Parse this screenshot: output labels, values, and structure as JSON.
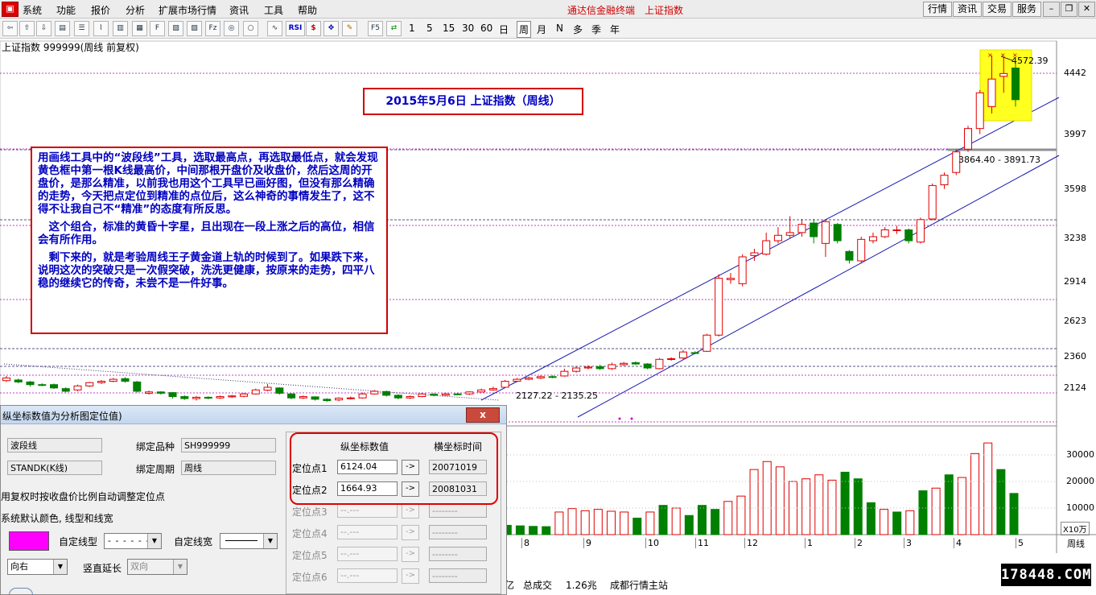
{
  "menu": {
    "items": [
      "系统",
      "功能",
      "报价",
      "分析",
      "扩展市场行情",
      "资讯",
      "工具",
      "帮助"
    ],
    "app_title": "通达信金融终端",
    "app_index": "上证指数",
    "right_buttons": [
      "行情",
      "资讯",
      "交易",
      "服务"
    ]
  },
  "toolbar": {
    "periods": [
      "1",
      "5",
      "15",
      "30",
      "60",
      "日",
      "周",
      "月",
      "N",
      "多",
      "季",
      "年"
    ],
    "active_period": "周",
    "icon_labels": [
      "RSI",
      "$"
    ]
  },
  "chart": {
    "title": "上证指数 999999(周线 前复权)",
    "header_box": "2015年5月6日   上证指数（周线）",
    "y_ticks": [
      "4442",
      "3997",
      "3598",
      "3238",
      "2914",
      "2623",
      "2360",
      "2124"
    ],
    "vol_ticks": [
      "30000",
      "20000",
      "10000"
    ],
    "vol_unit": "X10万",
    "x_labels": [
      "8",
      "9",
      "10",
      "11",
      "12",
      "1",
      "2",
      "3",
      "4",
      "5"
    ],
    "period_label": "周线",
    "annotations": {
      "high": "4572.39",
      "mid": "3864.40 - 3891.73",
      "low": "2127.22 - 2135.25"
    },
    "note": {
      "p1": "用画线工具中的“波段线”工具，选取最高点，再选取最低点，就会发现黄色框中第一根K线最高价，中间那根开盘价及收盘价，然后这周的开盘价，是那么精准，以前我也用这个工具早已画好图，但没有那么精确的走势，今天把点定位到精准的点位后，这么神奇的事情发生了，这不得不让我自己不“精准”的态度有所反思。",
      "p2": "　这个组合，标准的黄昏十字星，且出现在一段上涨之后的高位，相信会有所作用。",
      "p3": "　剩下来的，就是考验周线王子黄金道上轨的时候到了。如果跌下来，说明这次的突破只是一次假突破，洗洗更健康，按原来的走势，四平八稳的继续它的传奇，未尝不是一件好事。"
    },
    "candles": [
      {
        "o": 2180,
        "c": 2200,
        "h": 2215,
        "l": 2170,
        "up": true
      },
      {
        "o": 2185,
        "c": 2170,
        "h": 2195,
        "l": 2160,
        "up": false
      },
      {
        "o": 2170,
        "c": 2150,
        "h": 2178,
        "l": 2135,
        "up": false
      },
      {
        "o": 2150,
        "c": 2145,
        "h": 2160,
        "l": 2138,
        "up": false
      },
      {
        "o": 2150,
        "c": 2125,
        "h": 2158,
        "l": 2118,
        "up": false
      },
      {
        "o": 2120,
        "c": 2100,
        "h": 2130,
        "l": 2092,
        "up": false
      },
      {
        "o": 2110,
        "c": 2140,
        "h": 2150,
        "l": 2100,
        "up": true
      },
      {
        "o": 2140,
        "c": 2165,
        "h": 2170,
        "l": 2132,
        "up": true
      },
      {
        "o": 2165,
        "c": 2175,
        "h": 2185,
        "l": 2155,
        "up": true
      },
      {
        "o": 2175,
        "c": 2190,
        "h": 2200,
        "l": 2168,
        "up": true
      },
      {
        "o": 2195,
        "c": 2175,
        "h": 2205,
        "l": 2165,
        "up": false
      },
      {
        "o": 2170,
        "c": 2100,
        "h": 2178,
        "l": 2090,
        "up": false
      },
      {
        "o": 2085,
        "c": 2095,
        "h": 2105,
        "l": 2075,
        "up": true
      },
      {
        "o": 2095,
        "c": 2085,
        "h": 2100,
        "l": 2075,
        "up": false
      },
      {
        "o": 2090,
        "c": 2060,
        "h": 2095,
        "l": 2045,
        "up": false
      },
      {
        "o": 2060,
        "c": 2045,
        "h": 2070,
        "l": 2035,
        "up": false
      },
      {
        "o": 2045,
        "c": 2055,
        "h": 2065,
        "l": 2030,
        "up": true
      },
      {
        "o": 2055,
        "c": 2048,
        "h": 2062,
        "l": 2040,
        "up": false
      },
      {
        "o": 2050,
        "c": 2060,
        "h": 2068,
        "l": 2042,
        "up": true
      },
      {
        "o": 2058,
        "c": 2065,
        "h": 2072,
        "l": 2050,
        "up": true
      },
      {
        "o": 2062,
        "c": 2080,
        "h": 2088,
        "l": 2055,
        "up": true
      },
      {
        "o": 2080,
        "c": 2110,
        "h": 2120,
        "l": 2075,
        "up": true
      },
      {
        "o": 2108,
        "c": 2130,
        "h": 2155,
        "l": 2100,
        "up": true
      },
      {
        "o": 2125,
        "c": 2085,
        "h": 2130,
        "l": 2075,
        "up": false
      },
      {
        "o": 2080,
        "c": 2050,
        "h": 2085,
        "l": 2040,
        "up": false
      },
      {
        "o": 2050,
        "c": 2060,
        "h": 2068,
        "l": 2042,
        "up": true
      },
      {
        "o": 2058,
        "c": 2040,
        "h": 2062,
        "l": 2030,
        "up": false
      },
      {
        "o": 2040,
        "c": 2030,
        "h": 2048,
        "l": 2020,
        "up": false
      },
      {
        "o": 2035,
        "c": 2048,
        "h": 2055,
        "l": 2025,
        "up": true
      },
      {
        "o": 2045,
        "c": 2050,
        "h": 2060,
        "l": 2038,
        "up": true
      },
      {
        "o": 2050,
        "c": 2080,
        "h": 2090,
        "l": 2045,
        "up": true
      },
      {
        "o": 2080,
        "c": 2100,
        "h": 2110,
        "l": 2075,
        "up": true
      },
      {
        "o": 2098,
        "c": 2070,
        "h": 2105,
        "l": 2060,
        "up": false
      },
      {
        "o": 2070,
        "c": 2050,
        "h": 2078,
        "l": 2040,
        "up": false
      },
      {
        "o": 2050,
        "c": 2060,
        "h": 2068,
        "l": 2042,
        "up": true
      },
      {
        "o": 2060,
        "c": 2080,
        "h": 2088,
        "l": 2055,
        "up": true
      },
      {
        "o": 2078,
        "c": 2070,
        "h": 2085,
        "l": 2062,
        "up": false
      },
      {
        "o": 2070,
        "c": 2080,
        "h": 2090,
        "l": 2065,
        "up": true
      },
      {
        "o": 2080,
        "c": 2075,
        "h": 2088,
        "l": 2070,
        "up": false
      },
      {
        "o": 2080,
        "c": 2095,
        "h": 2100,
        "l": 2072,
        "up": true
      },
      {
        "o": 2095,
        "c": 2110,
        "h": 2120,
        "l": 2090,
        "up": true
      },
      {
        "o": 2110,
        "c": 2120,
        "h": 2135,
        "l": 2104,
        "up": true
      },
      {
        "o": 2130,
        "c": 2175,
        "h": 2185,
        "l": 2125,
        "up": true
      },
      {
        "o": 2175,
        "c": 2190,
        "h": 2200,
        "l": 2168,
        "up": true
      },
      {
        "o": 2190,
        "c": 2200,
        "h": 2210,
        "l": 2183,
        "up": true
      },
      {
        "o": 2200,
        "c": 2210,
        "h": 2220,
        "l": 2192,
        "up": true
      },
      {
        "o": 2210,
        "c": 2205,
        "h": 2220,
        "l": 2198,
        "up": false
      },
      {
        "o": 2215,
        "c": 2250,
        "h": 2270,
        "l": 2210,
        "up": true
      },
      {
        "o": 2250,
        "c": 2275,
        "h": 2285,
        "l": 2240,
        "up": true
      },
      {
        "o": 2275,
        "c": 2282,
        "h": 2295,
        "l": 2265,
        "up": true
      },
      {
        "o": 2285,
        "c": 2270,
        "h": 2300,
        "l": 2260,
        "up": false
      },
      {
        "o": 2270,
        "c": 2300,
        "h": 2315,
        "l": 2260,
        "up": true
      },
      {
        "o": 2300,
        "c": 2310,
        "h": 2320,
        "l": 2292,
        "up": true
      },
      {
        "o": 2315,
        "c": 2305,
        "h": 2325,
        "l": 2298,
        "up": false
      },
      {
        "o": 2305,
        "c": 2275,
        "h": 2312,
        "l": 2265,
        "up": false
      },
      {
        "o": 2270,
        "c": 2340,
        "h": 2350,
        "l": 2265,
        "up": true
      },
      {
        "o": 2340,
        "c": 2345,
        "h": 2355,
        "l": 2330,
        "up": true
      },
      {
        "o": 2350,
        "c": 2395,
        "h": 2410,
        "l": 2340,
        "up": true
      },
      {
        "o": 2390,
        "c": 2385,
        "h": 2400,
        "l": 2378,
        "up": false
      },
      {
        "o": 2400,
        "c": 2520,
        "h": 2530,
        "l": 2395,
        "up": true
      },
      {
        "o": 2520,
        "c": 2940,
        "h": 2970,
        "l": 2510,
        "up": true
      },
      {
        "o": 2930,
        "c": 2940,
        "h": 2980,
        "l": 2900,
        "up": true
      },
      {
        "o": 2900,
        "c": 3100,
        "h": 3120,
        "l": 2880,
        "up": true
      },
      {
        "o": 3110,
        "c": 3130,
        "h": 3160,
        "l": 3070,
        "up": true
      },
      {
        "o": 3120,
        "c": 3220,
        "h": 3280,
        "l": 3110,
        "up": true
      },
      {
        "o": 3220,
        "c": 3260,
        "h": 3320,
        "l": 3200,
        "up": true
      },
      {
        "o": 3260,
        "c": 3280,
        "h": 3400,
        "l": 3240,
        "up": true
      },
      {
        "o": 3280,
        "c": 3340,
        "h": 3380,
        "l": 3250,
        "up": true
      },
      {
        "o": 3350,
        "c": 3250,
        "h": 3380,
        "l": 3200,
        "up": false
      },
      {
        "o": 3200,
        "c": 3360,
        "h": 3380,
        "l": 3100,
        "up": true
      },
      {
        "o": 3340,
        "c": 3220,
        "h": 3350,
        "l": 3200,
        "up": false
      },
      {
        "o": 3140,
        "c": 3075,
        "h": 3150,
        "l": 3050,
        "up": false
      },
      {
        "o": 3070,
        "c": 3230,
        "h": 3250,
        "l": 3050,
        "up": true
      },
      {
        "o": 3220,
        "c": 3250,
        "h": 3280,
        "l": 3200,
        "up": true
      },
      {
        "o": 3250,
        "c": 3300,
        "h": 3320,
        "l": 3240,
        "up": true
      },
      {
        "o": 3300,
        "c": 3300,
        "h": 3330,
        "l": 3270,
        "up": true
      },
      {
        "o": 3300,
        "c": 3220,
        "h": 3310,
        "l": 3200,
        "up": false
      },
      {
        "o": 3210,
        "c": 3375,
        "h": 3390,
        "l": 3200,
        "up": true
      },
      {
        "o": 3380,
        "c": 3625,
        "h": 3640,
        "l": 3370,
        "up": true
      },
      {
        "o": 3630,
        "c": 3700,
        "h": 3720,
        "l": 3600,
        "up": true
      },
      {
        "o": 3720,
        "c": 3870,
        "h": 3890,
        "l": 3700,
        "up": true
      },
      {
        "o": 3890,
        "c": 4040,
        "h": 4060,
        "l": 3870,
        "up": true
      },
      {
        "o": 4040,
        "c": 4300,
        "h": 4320,
        "l": 4000,
        "up": true
      },
      {
        "o": 4200,
        "c": 4400,
        "h": 4572,
        "l": 4150,
        "up": true
      },
      {
        "o": 4420,
        "c": 4440,
        "h": 4560,
        "l": 4300,
        "up": true
      },
      {
        "o": 4480,
        "c": 4250,
        "h": 4520,
        "l": 4200,
        "up": false
      }
    ],
    "volumes": [
      {
        "v": 4000,
        "up": true
      },
      {
        "v": 3800,
        "up": false
      },
      {
        "v": 3500,
        "up": false
      },
      {
        "v": 3300,
        "up": false
      },
      {
        "v": 3100,
        "up": false
      },
      {
        "v": 3000,
        "up": false
      },
      {
        "v": 8500,
        "up": true
      },
      {
        "v": 9800,
        "up": true
      },
      {
        "v": 9000,
        "up": true
      },
      {
        "v": 9500,
        "up": true
      },
      {
        "v": 8800,
        "up": true
      },
      {
        "v": 8500,
        "up": true
      },
      {
        "v": 6200,
        "up": false
      },
      {
        "v": 8500,
        "up": true
      },
      {
        "v": 11000,
        "up": false
      },
      {
        "v": 10000,
        "up": true
      },
      {
        "v": 7200,
        "up": false
      },
      {
        "v": 11000,
        "up": false
      },
      {
        "v": 9500,
        "up": false
      },
      {
        "v": 12500,
        "up": true
      },
      {
        "v": 14500,
        "up": true
      },
      {
        "v": 24500,
        "up": true
      },
      {
        "v": 27500,
        "up": true
      },
      {
        "v": 25500,
        "up": true
      },
      {
        "v": 20000,
        "up": true
      },
      {
        "v": 21000,
        "up": true
      },
      {
        "v": 22500,
        "up": true
      },
      {
        "v": 20500,
        "up": true
      },
      {
        "v": 23500,
        "up": false
      },
      {
        "v": 21000,
        "up": false
      },
      {
        "v": 12000,
        "up": false
      },
      {
        "v": 9500,
        "up": true
      },
      {
        "v": 8500,
        "up": false
      },
      {
        "v": 9000,
        "up": true
      },
      {
        "v": 16500,
        "up": false
      },
      {
        "v": 17500,
        "up": true
      },
      {
        "v": 22500,
        "up": false
      },
      {
        "v": 21500,
        "up": true
      },
      {
        "v": 30500,
        "up": true
      },
      {
        "v": 34500,
        "up": true
      },
      {
        "v": 24500,
        "up": false
      },
      {
        "v": 15500,
        "up": false
      }
    ]
  },
  "dialog": {
    "title": "纵坐标数值为分析图定位值)",
    "close": "x",
    "tool_name": "波段线",
    "indicator": "STANDK(K线)",
    "bind_symbol_label": "绑定品种",
    "bind_symbol_value": "SH999999",
    "bind_period_label": "绑定周期",
    "bind_period_value": "周线",
    "auto_adjust": "用复权时按收盘价比例自动调整定位点",
    "default_style": "系统默认颜色, 线型和线宽",
    "line_type_label": "自定线型",
    "line_width_label": "自定线宽",
    "direction_value": "向右",
    "vertical_ext_label": "竖直延长",
    "vertical_ext_value": "双向",
    "col_y": "纵坐标数值",
    "col_x": "横坐标时间",
    "points": [
      {
        "label": "定位点1",
        "value": "6124.04",
        "time": "20071019"
      },
      {
        "label": "定位点2",
        "value": "1664.93",
        "time": "20081031"
      },
      {
        "label": "定位点3",
        "value": "--.---",
        "time": "--------"
      },
      {
        "label": "定位点4",
        "value": "--.---",
        "time": "--------"
      },
      {
        "label": "定位点5",
        "value": "--.---",
        "time": "--------"
      },
      {
        "label": "定位点6",
        "value": "--.---",
        "time": "--------"
      },
      {
        "label": "定位点7",
        "value": "",
        "time": ""
      }
    ],
    "arrow": "->",
    "color_swatch": "#ff00ff"
  },
  "status": {
    "unit": "亿",
    "total_label": "总成交",
    "total_value": "1.26兆",
    "station": "成都行情主站"
  },
  "watermark": "178448.COM",
  "colors": {
    "up": "#e00000",
    "down": "#008000",
    "line": "#1a1ab0",
    "accent_red": "#d00000"
  }
}
